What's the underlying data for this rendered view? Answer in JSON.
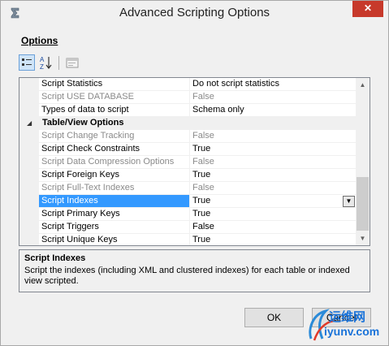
{
  "window": {
    "title": "Advanced Scripting Options",
    "close_glyph": "✕"
  },
  "options_label": "Options",
  "toolbar": {
    "categorized_icon": "categorized-icon",
    "alphabetical_icon": "sort-az-icon",
    "property_pages_icon": "property-pages-icon"
  },
  "grid": {
    "rows": [
      {
        "name": "Script Statistics",
        "value": "Do not script statistics",
        "state": "normal"
      },
      {
        "name": "Script USE DATABASE",
        "value": "False",
        "state": "disabled"
      },
      {
        "name": "Types of data to script",
        "value": "Schema only",
        "state": "normal"
      },
      {
        "name": "Table/View Options",
        "value": "",
        "state": "category"
      },
      {
        "name": "Script Change Tracking",
        "value": "False",
        "state": "disabled"
      },
      {
        "name": "Script Check Constraints",
        "value": "True",
        "state": "normal"
      },
      {
        "name": "Script Data Compression Options",
        "value": "False",
        "state": "disabled"
      },
      {
        "name": "Script Foreign Keys",
        "value": "True",
        "state": "normal"
      },
      {
        "name": "Script Full-Text Indexes",
        "value": "False",
        "state": "disabled"
      },
      {
        "name": "Script Indexes",
        "value": "True",
        "state": "selected"
      },
      {
        "name": "Script Primary Keys",
        "value": "True",
        "state": "normal"
      },
      {
        "name": "Script Triggers",
        "value": "False",
        "state": "normal"
      },
      {
        "name": "Script Unique Keys",
        "value": "True",
        "state": "normal"
      }
    ]
  },
  "description": {
    "title": "Script Indexes",
    "text": "Script the indexes (including XML and clustered indexes) for each table or indexed view scripted."
  },
  "buttons": {
    "ok": "OK",
    "cancel": "Cancel"
  },
  "watermark": {
    "line1": "运维网",
    "line2": "iyunv.com"
  },
  "colors": {
    "selection": "#3399ff",
    "close_button": "#c7392b",
    "disabled_text": "#8a8a8a"
  }
}
